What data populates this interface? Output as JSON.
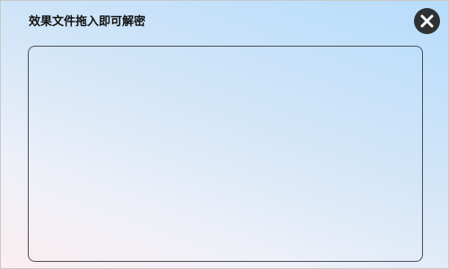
{
  "dialog": {
    "title": "效果文件拖入即可解密",
    "close_icon": "close-icon",
    "accent_color": "#2f3235"
  }
}
